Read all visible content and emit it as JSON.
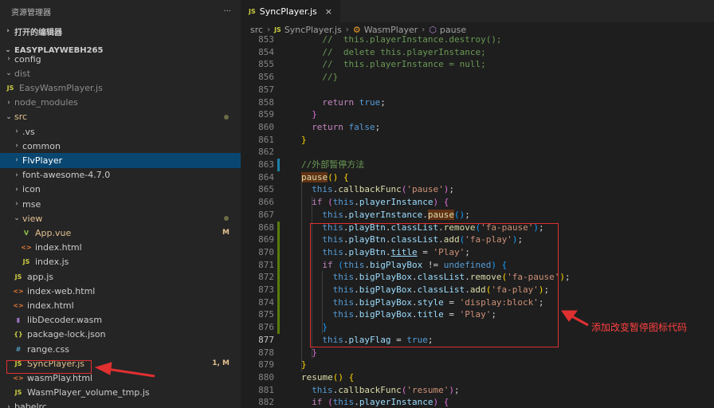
{
  "sidebar": {
    "header_title": "资源管理器",
    "more_label": "···",
    "open_editors": "打开的编辑器",
    "project": "EASYPLAYWEBH265",
    "items": [
      {
        "label": "config",
        "kind": "folder",
        "depth": 1,
        "open": false
      },
      {
        "label": "dist",
        "kind": "folder",
        "depth": 1,
        "open": true,
        "dim": true
      },
      {
        "label": "EasyWasmPlayer.js",
        "kind": "js",
        "depth": 1,
        "dim": true
      },
      {
        "label": "node_modules",
        "kind": "folder",
        "depth": 1,
        "open": false,
        "dim": true
      },
      {
        "label": "src",
        "kind": "folder",
        "depth": 1,
        "open": true,
        "color": "#e2c08d",
        "dot": true
      },
      {
        "label": ".vs",
        "kind": "folder",
        "depth": 2,
        "open": false
      },
      {
        "label": "common",
        "kind": "folder",
        "depth": 2,
        "open": false
      },
      {
        "label": "FlvPlayer",
        "kind": "folder",
        "depth": 2,
        "open": false,
        "selected": true
      },
      {
        "label": "font-awesome-4.7.0",
        "kind": "folder",
        "depth": 2,
        "open": false
      },
      {
        "label": "icon",
        "kind": "folder",
        "depth": 2,
        "open": false
      },
      {
        "label": "mse",
        "kind": "folder",
        "depth": 2,
        "open": false
      },
      {
        "label": "view",
        "kind": "folder",
        "depth": 2,
        "open": true,
        "color": "#e2c08d",
        "dot": true
      },
      {
        "label": "App.vue",
        "kind": "vue",
        "depth": 3,
        "color": "#e2c08d",
        "badge": "M"
      },
      {
        "label": "index.html",
        "kind": "html",
        "depth": 3
      },
      {
        "label": "index.js",
        "kind": "js",
        "depth": 3
      },
      {
        "label": "app.js",
        "kind": "js",
        "depth": 2
      },
      {
        "label": "index-web.html",
        "kind": "html",
        "depth": 2
      },
      {
        "label": "index.html",
        "kind": "html",
        "depth": 2
      },
      {
        "label": "libDecoder.wasm",
        "kind": "wasm",
        "depth": 2
      },
      {
        "label": "package-lock.json",
        "kind": "json",
        "depth": 2
      },
      {
        "label": "range.css",
        "kind": "css",
        "depth": 2
      },
      {
        "label": "SyncPlayer.js",
        "kind": "js",
        "depth": 2,
        "color": "#e2c08d",
        "badge": "1, M"
      },
      {
        "label": "wasmPlay.html",
        "kind": "html",
        "depth": 2
      },
      {
        "label": "WasmPlayer_volume_tmp.js",
        "kind": "js",
        "depth": 2
      },
      {
        "label": "babelrc",
        "kind": "folder",
        "depth": 1,
        "open": false
      }
    ]
  },
  "editor": {
    "tab_label": "SyncPlayer.js",
    "tab_close": "×",
    "breadcrumb": {
      "src": "src",
      "file": "SyncPlayer.js",
      "cls": "WasmPlayer",
      "method": "pause"
    },
    "lines": [
      {
        "n": "853",
        "indent": 2,
        "tokens": [
          [
            "c",
            "//  this.playerInstance.destroy();"
          ]
        ]
      },
      {
        "n": "854",
        "indent": 2,
        "tokens": [
          [
            "c",
            "//  delete this.playerInstance;"
          ]
        ]
      },
      {
        "n": "855",
        "indent": 2,
        "tokens": [
          [
            "c",
            "//  this.playerInstance = null;"
          ]
        ]
      },
      {
        "n": "856",
        "indent": 2,
        "tokens": [
          [
            "c",
            "//}"
          ]
        ]
      },
      {
        "n": "857",
        "indent": 0,
        "tokens": []
      },
      {
        "n": "858",
        "indent": 2,
        "tokens": [
          [
            "cf",
            "return "
          ],
          [
            "k",
            "true"
          ],
          [
            "t",
            ";"
          ]
        ]
      },
      {
        "n": "859",
        "indent": 1,
        "tokens": [
          [
            "b2",
            "}"
          ]
        ]
      },
      {
        "n": "860",
        "indent": 1,
        "tokens": [
          [
            "cf",
            "return "
          ],
          [
            "k",
            "false"
          ],
          [
            "t",
            ";"
          ]
        ]
      },
      {
        "n": "861",
        "indent": 0,
        "tokens": [
          [
            "b",
            "}"
          ]
        ]
      },
      {
        "n": "862",
        "indent": 0,
        "tokens": []
      },
      {
        "n": "863",
        "indent": 0,
        "tokens": [
          [
            "c",
            "//外部暂停方法"
          ]
        ]
      },
      {
        "n": "864",
        "indent": 0,
        "tokens": [
          [
            "fh",
            "pause"
          ],
          [
            "b",
            "()"
          ],
          [
            "t",
            " "
          ],
          [
            "b",
            "{"
          ]
        ]
      },
      {
        "n": "865",
        "indent": 1,
        "tokens": [
          [
            "k",
            "this"
          ],
          [
            "t",
            "."
          ],
          [
            "f",
            "callbackFunc"
          ],
          [
            "b2",
            "("
          ],
          [
            "s",
            "'pause'"
          ],
          [
            "b2",
            ")"
          ],
          [
            "t",
            ";"
          ]
        ]
      },
      {
        "n": "866",
        "indent": 1,
        "tokens": [
          [
            "cf",
            "if "
          ],
          [
            "b2",
            "("
          ],
          [
            "k",
            "this"
          ],
          [
            "t",
            "."
          ],
          [
            "p",
            "playerInstance"
          ],
          [
            "b2",
            ")"
          ],
          [
            "t",
            " "
          ],
          [
            "b2",
            "{"
          ]
        ]
      },
      {
        "n": "867",
        "indent": 2,
        "tokens": [
          [
            "k",
            "this"
          ],
          [
            "t",
            "."
          ],
          [
            "p",
            "playerInstance"
          ],
          [
            "t",
            "."
          ],
          [
            "fh",
            "pause"
          ],
          [
            "b3",
            "()"
          ],
          [
            "t",
            ";"
          ]
        ]
      },
      {
        "n": "868",
        "indent": 2,
        "tokens": [
          [
            "k",
            "this"
          ],
          [
            "t",
            "."
          ],
          [
            "p",
            "playBtn"
          ],
          [
            "t",
            "."
          ],
          [
            "p",
            "classList"
          ],
          [
            "t",
            "."
          ],
          [
            "f",
            "remove"
          ],
          [
            "b3",
            "("
          ],
          [
            "s",
            "'fa-pause'"
          ],
          [
            "b3",
            ")"
          ],
          [
            "t",
            ";"
          ]
        ]
      },
      {
        "n": "869",
        "indent": 2,
        "tokens": [
          [
            "k",
            "this"
          ],
          [
            "t",
            "."
          ],
          [
            "p",
            "playBtn"
          ],
          [
            "t",
            "."
          ],
          [
            "p",
            "classList"
          ],
          [
            "t",
            "."
          ],
          [
            "f",
            "add"
          ],
          [
            "b3",
            "("
          ],
          [
            "s",
            "'fa-play'"
          ],
          [
            "b3",
            ")"
          ],
          [
            "t",
            ";"
          ]
        ]
      },
      {
        "n": "870",
        "indent": 2,
        "tokens": [
          [
            "k",
            "this"
          ],
          [
            "t",
            "."
          ],
          [
            "p",
            "playBtn"
          ],
          [
            "t",
            "."
          ],
          [
            "pu",
            "title"
          ],
          [
            "t",
            " = "
          ],
          [
            "s",
            "'Play'"
          ],
          [
            "t",
            ";"
          ]
        ]
      },
      {
        "n": "871",
        "indent": 2,
        "tokens": [
          [
            "cf",
            "if "
          ],
          [
            "b3",
            "("
          ],
          [
            "k",
            "this"
          ],
          [
            "t",
            "."
          ],
          [
            "p",
            "bigPlayBox"
          ],
          [
            "t",
            " != "
          ],
          [
            "k",
            "undefined"
          ],
          [
            "b3",
            ")"
          ],
          [
            "t",
            " "
          ],
          [
            "b3",
            "{"
          ]
        ]
      },
      {
        "n": "872",
        "indent": 3,
        "tokens": [
          [
            "k",
            "this"
          ],
          [
            "t",
            "."
          ],
          [
            "p",
            "bigPlayBox"
          ],
          [
            "t",
            "."
          ],
          [
            "p",
            "classList"
          ],
          [
            "t",
            "."
          ],
          [
            "f",
            "remove"
          ],
          [
            "b",
            "("
          ],
          [
            "s",
            "'fa-pause'"
          ],
          [
            "b",
            ")"
          ],
          [
            "t",
            ";"
          ]
        ]
      },
      {
        "n": "873",
        "indent": 3,
        "tokens": [
          [
            "k",
            "this"
          ],
          [
            "t",
            "."
          ],
          [
            "p",
            "bigPlayBox"
          ],
          [
            "t",
            "."
          ],
          [
            "p",
            "classList"
          ],
          [
            "t",
            "."
          ],
          [
            "f",
            "add"
          ],
          [
            "b",
            "("
          ],
          [
            "s",
            "'fa-play'"
          ],
          [
            "b",
            ")"
          ],
          [
            "t",
            ";"
          ]
        ]
      },
      {
        "n": "874",
        "indent": 3,
        "tokens": [
          [
            "k",
            "this"
          ],
          [
            "t",
            "."
          ],
          [
            "p",
            "bigPlayBox"
          ],
          [
            "t",
            "."
          ],
          [
            "p",
            "style"
          ],
          [
            "t",
            " = "
          ],
          [
            "s",
            "'display:block'"
          ],
          [
            "t",
            ";"
          ]
        ]
      },
      {
        "n": "875",
        "indent": 3,
        "tokens": [
          [
            "k",
            "this"
          ],
          [
            "t",
            "."
          ],
          [
            "p",
            "bigPlayBox"
          ],
          [
            "t",
            "."
          ],
          [
            "p",
            "title"
          ],
          [
            "t",
            " = "
          ],
          [
            "s",
            "'Play'"
          ],
          [
            "t",
            ";"
          ]
        ]
      },
      {
        "n": "876",
        "indent": 2,
        "tokens": [
          [
            "b3",
            "}"
          ]
        ]
      },
      {
        "n": "877",
        "indent": 2,
        "tokens": [
          [
            "k",
            "this"
          ],
          [
            "t",
            "."
          ],
          [
            "p",
            "playFlag"
          ],
          [
            "t",
            " = "
          ],
          [
            "k",
            "true"
          ],
          [
            "t",
            ";"
          ]
        ]
      },
      {
        "n": "878",
        "indent": 1,
        "tokens": [
          [
            "b2",
            "}"
          ]
        ]
      },
      {
        "n": "879",
        "indent": 0,
        "tokens": [
          [
            "b",
            "}"
          ]
        ]
      },
      {
        "n": "880",
        "indent": 0,
        "tokens": [
          [
            "f",
            "resume"
          ],
          [
            "b",
            "()"
          ],
          [
            "t",
            " "
          ],
          [
            "b",
            "{"
          ]
        ]
      },
      {
        "n": "881",
        "indent": 1,
        "tokens": [
          [
            "k",
            "this"
          ],
          [
            "t",
            "."
          ],
          [
            "f",
            "callbackFunc"
          ],
          [
            "b2",
            "("
          ],
          [
            "s",
            "'resume'"
          ],
          [
            "b2",
            ")"
          ],
          [
            "t",
            ";"
          ]
        ]
      },
      {
        "n": "882",
        "indent": 1,
        "tokens": [
          [
            "cf",
            "if "
          ],
          [
            "b2",
            "("
          ],
          [
            "k",
            "this"
          ],
          [
            "t",
            "."
          ],
          [
            "p",
            "playerInstance"
          ],
          [
            "b2",
            ")"
          ],
          [
            "t",
            " "
          ],
          [
            "b2",
            "{"
          ]
        ]
      }
    ],
    "current_line": "877",
    "modified_lines": [
      "868",
      "869",
      "870",
      "871",
      "872",
      "873",
      "874",
      "875",
      "876"
    ]
  },
  "annotation": {
    "text": "添加改变暂停图标代码",
    "color": "#ff4040"
  }
}
